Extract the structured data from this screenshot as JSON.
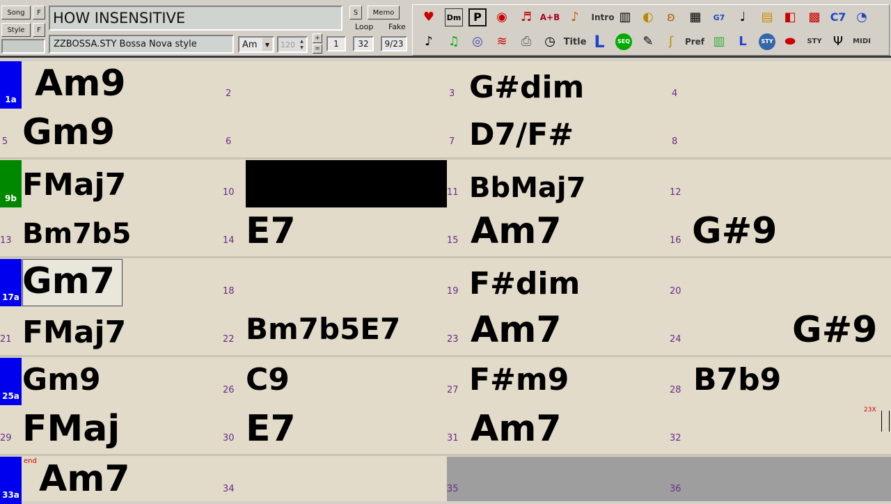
{
  "header": {
    "song_button": "Song",
    "style_button": "Style",
    "f_label": "F",
    "s_label": "S",
    "memo_label": "Memo",
    "loop_label": "Loop",
    "fake_label": "Fake",
    "title": "HOW INSENSITIVE",
    "style_name": "ZZBOSSA.STY Bossa Nova style",
    "key": "Am",
    "tempo": "120",
    "start_bar": "1",
    "end_bar": "32",
    "bar_position": "9/23"
  },
  "toolbar": {
    "row1": [
      "heart-icon",
      "dm-icon",
      "p-icon",
      "radio-icon",
      "grand-piano-icon",
      "A+B",
      "guitar-icon",
      "Intro",
      "keyboard-icon",
      "horn-icon",
      "ear-icon",
      "waveform-icon",
      "G7",
      "sheet-icon",
      "notepad-icon",
      "record-icon",
      "grid-icon",
      "C7",
      "gauge-icon"
    ],
    "row2": [
      "note-icon",
      "green-note-icon",
      "drum-icon",
      "wave-icon",
      "printer-icon",
      "clock-icon",
      "Title",
      "L",
      "SEQ",
      "guitarist-icon",
      "sax-icon",
      "Pref",
      "mixer-icon",
      "L",
      "STY",
      "pill-icon",
      "STY",
      "tuning-fork-icon",
      "MIDI"
    ]
  },
  "sheet": {
    "cells": [
      {
        "bar": "1a",
        "chord": "Am9"
      },
      {
        "bar": "2",
        "chord": ""
      },
      {
        "bar": "3",
        "chord": "G#dim"
      },
      {
        "bar": "4",
        "chord": ""
      },
      {
        "bar": "5",
        "chord": "Gm9"
      },
      {
        "bar": "6",
        "chord": ""
      },
      {
        "bar": "7",
        "chord": "D7/F#"
      },
      {
        "bar": "8",
        "chord": ""
      },
      {
        "bar": "9b",
        "chord": "FMaj7"
      },
      {
        "bar": "10",
        "chord": ""
      },
      {
        "bar": "11",
        "chord": "BbMaj7"
      },
      {
        "bar": "12",
        "chord": ""
      },
      {
        "bar": "13",
        "chord": "Bm7b5"
      },
      {
        "bar": "14",
        "chord": "E7"
      },
      {
        "bar": "15",
        "chord": "Am7"
      },
      {
        "bar": "16",
        "chord": "G#9"
      },
      {
        "bar": "17a",
        "chord": "Gm7"
      },
      {
        "bar": "18",
        "chord": ""
      },
      {
        "bar": "19",
        "chord": "F#dim"
      },
      {
        "bar": "20",
        "chord": ""
      },
      {
        "bar": "21",
        "chord": "FMaj7"
      },
      {
        "bar": "22",
        "chord": "Bm7b5E7"
      },
      {
        "bar": "23",
        "chord": "Am7"
      },
      {
        "bar": "24",
        "chord": "G#9"
      },
      {
        "bar": "25a",
        "chord": "Gm9"
      },
      {
        "bar": "26",
        "chord": "C9"
      },
      {
        "bar": "27",
        "chord": "F#m9"
      },
      {
        "bar": "28",
        "chord": "B7b9"
      },
      {
        "bar": "29",
        "chord": "FMaj"
      },
      {
        "bar": "30",
        "chord": "E7"
      },
      {
        "bar": "31",
        "chord": "Am7"
      },
      {
        "bar": "32",
        "chord": ""
      },
      {
        "bar": "33a",
        "chord": "Am7"
      },
      {
        "bar": "34",
        "chord": ""
      },
      {
        "bar": "35",
        "chord": ""
      },
      {
        "bar": "36",
        "chord": ""
      }
    ],
    "end_marker": "end",
    "zoom_label": "23X",
    "colors": {
      "part_a": "#0000ee",
      "part_b": "#008800",
      "sheet_bg": "#e2dbc9"
    }
  }
}
